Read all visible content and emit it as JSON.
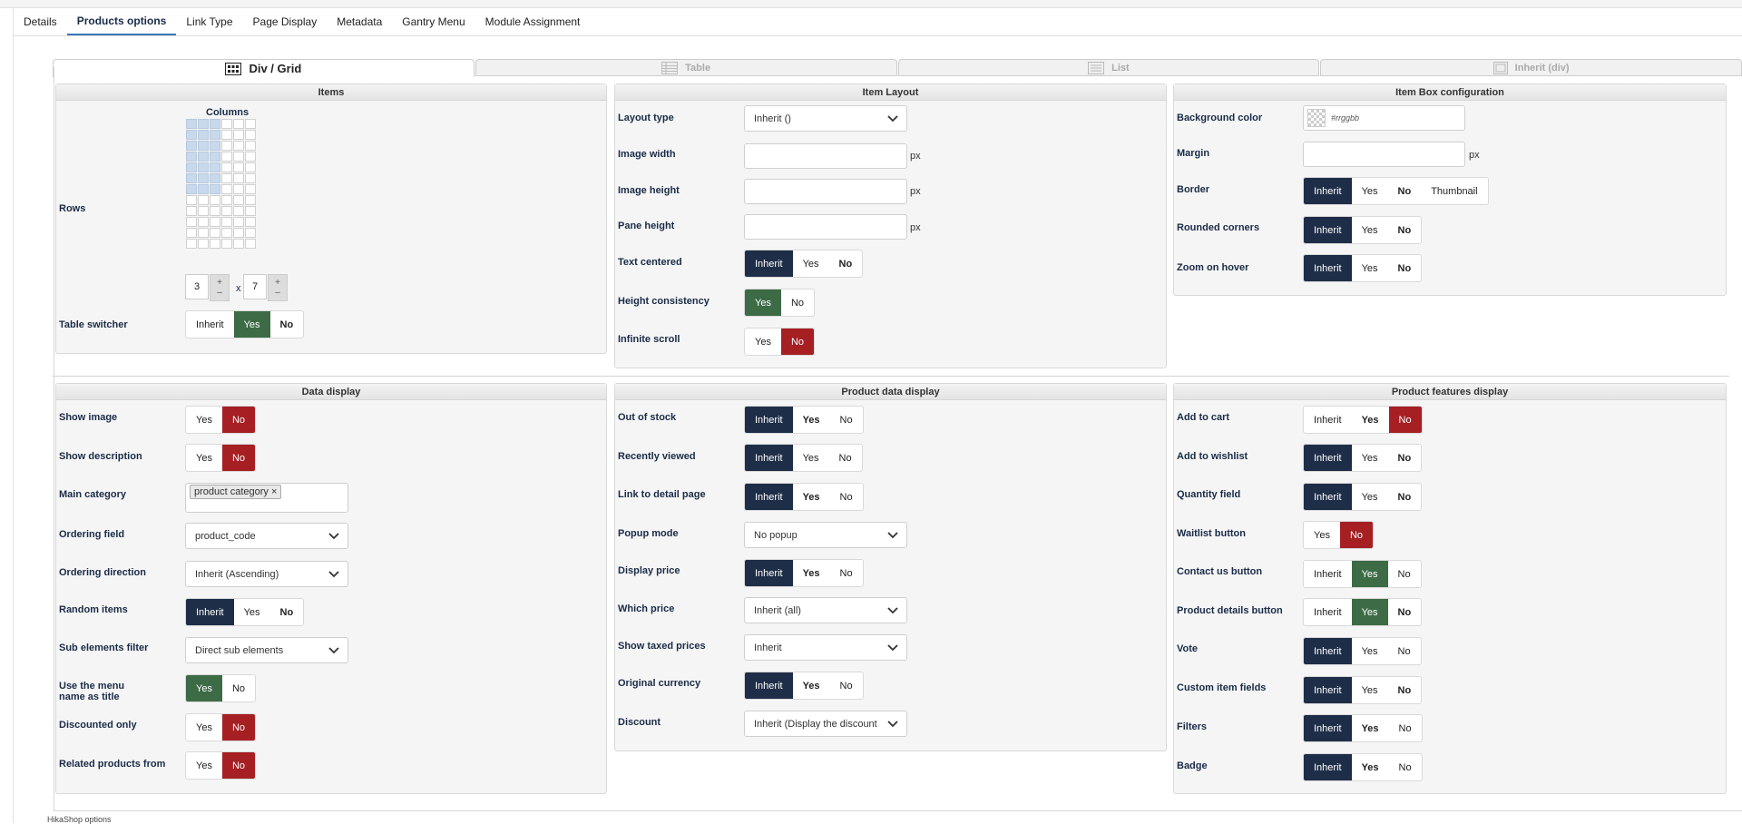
{
  "tabs": [
    "Details",
    "Products options",
    "Link Type",
    "Page Display",
    "Metadata",
    "Gantry Menu",
    "Module Assignment"
  ],
  "layout_tabs": [
    "Div / Grid",
    "Table",
    "List",
    "Inherit (div)"
  ],
  "items": {
    "title": "Items",
    "columns_label": "Columns",
    "rows_label": "Rows",
    "rows_value": "3",
    "cols_value": "7",
    "x": "x",
    "plus": "+",
    "minus": "–",
    "table_switcher": "Table switcher"
  },
  "item_layout": {
    "title": "Item Layout",
    "layout_type": "Layout type",
    "layout_type_value": "Inherit ()",
    "image_width": "Image width",
    "image_height": "Image height",
    "pane_height": "Pane height",
    "px": "px",
    "text_centered": "Text centered",
    "height_consistency": "Height consistency",
    "infinite_scroll": "Infinite scroll"
  },
  "item_box": {
    "title": "Item Box configuration",
    "bg_color": "Background color",
    "bg_placeholder": "#rrggbb",
    "margin": "Margin",
    "border": "Border",
    "rounded": "Rounded corners",
    "zoom": "Zoom on hover"
  },
  "data_display": {
    "title": "Data display",
    "show_image": "Show image",
    "show_description": "Show description",
    "main_category": "Main category",
    "main_category_tag": "product category",
    "tag_x": "×",
    "ordering_field": "Ordering field",
    "ordering_field_value": "product_code",
    "ordering_direction": "Ordering direction",
    "ordering_direction_value": "Inherit (Ascending)",
    "random_items": "Random items",
    "sub_filter": "Sub elements filter",
    "sub_filter_value": "Direct sub elements",
    "use_menu_1": "Use the menu",
    "use_menu_2": "name as title",
    "discounted_only": "Discounted only",
    "related_from": "Related products from"
  },
  "product_data": {
    "title": "Product data display",
    "out_of_stock": "Out of stock",
    "recently_viewed": "Recently viewed",
    "link_detail": "Link to detail page",
    "popup_mode": "Popup mode",
    "popup_mode_value": "No popup",
    "display_price": "Display price",
    "which_price": "Which price",
    "which_price_value": "Inherit (all)",
    "taxed": "Show taxed prices",
    "taxed_value": "Inherit",
    "original_currency": "Original currency",
    "discount": "Discount",
    "discount_value": "Inherit (Display the discount"
  },
  "product_features": {
    "title": "Product features display",
    "add_to_cart": "Add to cart",
    "add_to_wishlist": "Add to wishlist",
    "quantity_field": "Quantity field",
    "waitlist": "Waitlist button",
    "contact_us": "Contact us button",
    "product_details": "Product details button",
    "vote": "Vote",
    "custom_fields": "Custom item fields",
    "filters": "Filters",
    "badge": "Badge"
  },
  "btn": {
    "inherit": "Inherit",
    "yes": "Yes",
    "no": "No",
    "thumbnail": "Thumbnail"
  },
  "bottom": "HikaShop options",
  "colors": {
    "navy": "#1f2e48",
    "green": "#3c6b45",
    "red": "#a51f23",
    "accent": "#3a79b8"
  }
}
